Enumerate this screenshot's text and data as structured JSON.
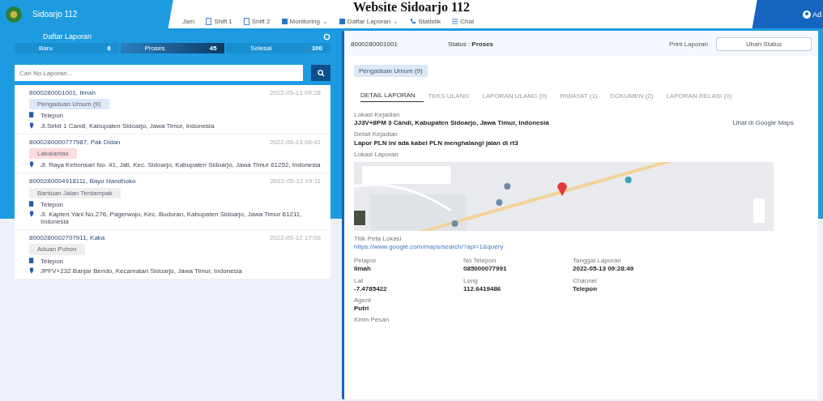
{
  "caption": "Website Sidoarjo 112",
  "brand": "Sidoarjo 112",
  "nav": [
    {
      "label": "Jam"
    },
    {
      "label": "Shift 1"
    },
    {
      "label": "Shift 2"
    },
    {
      "label": "Monitoring",
      "caret": "⌄"
    },
    {
      "label": "Daftar Laporan",
      "caret": "⌄"
    },
    {
      "label": "Statistik"
    },
    {
      "label": "Chat"
    }
  ],
  "user": "Ad",
  "list": {
    "title": "Daftar Laporan",
    "tabs": [
      {
        "label": "Baru",
        "count": "8",
        "selected": false
      },
      {
        "label": "Proses",
        "count": "45",
        "selected": true
      },
      {
        "label": "Selesai",
        "count": "100",
        "selected": false
      }
    ],
    "search": {
      "placeholder": "Cari No Laporan..."
    },
    "reports": [
      {
        "title": "8000280001001, Ilmah",
        "time": "2022-05-13 09:28",
        "tag": "Pengaduan Umum (9)",
        "color": "#dbe8f8",
        "channel": "Telepon",
        "address": "Jl.Sirkit 1 Candi, Kabupaten Sidoarjo, Jawa Timur, Indonesia"
      },
      {
        "title": "8000280000777987, Pak Didan",
        "time": "2022-05-13 08:41",
        "tag": "Lakalantas",
        "color": "#fcdcdc",
        "address": "Jl. Raya Kebonsari No. 41, Jati, Kec. Sidoarjo, Kabupaten Sidoarjo, Jawa Timur 61252, Indonesia"
      },
      {
        "title": "8000280004918111, Bayu Handhoko",
        "time": "2022-05-12 19:11",
        "tag": "Bantuan Jalan Terdampak",
        "color": "#eeeeee",
        "channel": "Telepon",
        "address": "Jl. Kapten Yani No.276, Pagerwojo, Kec. Buduran, Kabupaten Sidoarjo, Jawa Timur 61211, Indonesia"
      },
      {
        "title": "8000280002707911, Kaka",
        "time": "2022-05-12 17:06",
        "tag": "Aduan Pohon",
        "color": "#eeeeee",
        "channel": "Telepon",
        "address": "JPFV+232 Banjar Bendo, Kecamatan Sidoarjo, Jawa Timur, Indonesia"
      }
    ]
  },
  "detail": {
    "id": "8000280001001",
    "status_label": "Status :",
    "status": "Proses",
    "print": "Print Laporan",
    "action": "Ubah Status",
    "chip": "Pengaduan Umum (9)",
    "tabs": [
      {
        "label": "DETAIL LAPORAN",
        "selected": true
      },
      {
        "label": "TEKS ULANG",
        "selected": false
      },
      {
        "label": "LAPORAN ULANG (0)",
        "selected": false
      },
      {
        "label": "RIWAYAT (1)",
        "selected": false
      },
      {
        "label": "DOKUMEN (2)",
        "selected": false
      },
      {
        "label": "LAPORAN RELASI (0)",
        "selected": false
      }
    ],
    "location": {
      "label": "Lokasi Kejadian",
      "value": "JJ3V+8PM 3 Candi, Kabupaten Sidoarjo, Jawa Timur, Indonesia",
      "link": "Lihat di Google Maps"
    },
    "description": {
      "label": "Detail Kejadian",
      "value": "Lapor PLN ini ada kabel PLN menghalangi jalan di rt3"
    },
    "map_label": "Lokasi Laporan",
    "point": {
      "label": "Titik Peta Lokasi",
      "link": "https://www.google.com/maps/search/?api=1&query"
    },
    "fields": [
      {
        "label": "Pelapor",
        "value": "Ilmah"
      },
      {
        "label": "No Telepon",
        "value": "085000077991"
      },
      {
        "label": "Tanggal Laporan",
        "value": "2022-05-13 09:28:49"
      },
      {
        "label": "Lat",
        "value": "-7.4785422"
      },
      {
        "label": "Long",
        "value": "112.6419486"
      },
      {
        "label": "Channel",
        "value": "Telepon"
      },
      {
        "label": "Agent",
        "value": "Putri"
      }
    ],
    "footer": "Kirim Pesan"
  }
}
